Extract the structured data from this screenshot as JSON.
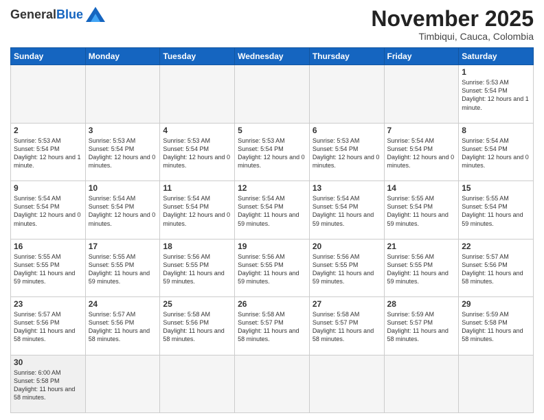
{
  "header": {
    "logo": {
      "general": "General",
      "blue": "Blue"
    },
    "title": "November 2025",
    "subtitle": "Timbiqui, Cauca, Colombia"
  },
  "days_of_week": [
    "Sunday",
    "Monday",
    "Tuesday",
    "Wednesday",
    "Thursday",
    "Friday",
    "Saturday"
  ],
  "weeks": [
    [
      {
        "day": "",
        "info": ""
      },
      {
        "day": "",
        "info": ""
      },
      {
        "day": "",
        "info": ""
      },
      {
        "day": "",
        "info": ""
      },
      {
        "day": "",
        "info": ""
      },
      {
        "day": "",
        "info": ""
      },
      {
        "day": "1",
        "info": "Sunrise: 5:53 AM\nSunset: 5:54 PM\nDaylight: 12 hours and 1 minute."
      }
    ],
    [
      {
        "day": "2",
        "info": "Sunrise: 5:53 AM\nSunset: 5:54 PM\nDaylight: 12 hours and 1 minute."
      },
      {
        "day": "3",
        "info": "Sunrise: 5:53 AM\nSunset: 5:54 PM\nDaylight: 12 hours and 0 minutes."
      },
      {
        "day": "4",
        "info": "Sunrise: 5:53 AM\nSunset: 5:54 PM\nDaylight: 12 hours and 0 minutes."
      },
      {
        "day": "5",
        "info": "Sunrise: 5:53 AM\nSunset: 5:54 PM\nDaylight: 12 hours and 0 minutes."
      },
      {
        "day": "6",
        "info": "Sunrise: 5:53 AM\nSunset: 5:54 PM\nDaylight: 12 hours and 0 minutes."
      },
      {
        "day": "7",
        "info": "Sunrise: 5:54 AM\nSunset: 5:54 PM\nDaylight: 12 hours and 0 minutes."
      },
      {
        "day": "8",
        "info": "Sunrise: 5:54 AM\nSunset: 5:54 PM\nDaylight: 12 hours and 0 minutes."
      }
    ],
    [
      {
        "day": "9",
        "info": "Sunrise: 5:54 AM\nSunset: 5:54 PM\nDaylight: 12 hours and 0 minutes."
      },
      {
        "day": "10",
        "info": "Sunrise: 5:54 AM\nSunset: 5:54 PM\nDaylight: 12 hours and 0 minutes."
      },
      {
        "day": "11",
        "info": "Sunrise: 5:54 AM\nSunset: 5:54 PM\nDaylight: 12 hours and 0 minutes."
      },
      {
        "day": "12",
        "info": "Sunrise: 5:54 AM\nSunset: 5:54 PM\nDaylight: 11 hours and 59 minutes."
      },
      {
        "day": "13",
        "info": "Sunrise: 5:54 AM\nSunset: 5:54 PM\nDaylight: 11 hours and 59 minutes."
      },
      {
        "day": "14",
        "info": "Sunrise: 5:55 AM\nSunset: 5:54 PM\nDaylight: 11 hours and 59 minutes."
      },
      {
        "day": "15",
        "info": "Sunrise: 5:55 AM\nSunset: 5:54 PM\nDaylight: 11 hours and 59 minutes."
      }
    ],
    [
      {
        "day": "16",
        "info": "Sunrise: 5:55 AM\nSunset: 5:55 PM\nDaylight: 11 hours and 59 minutes."
      },
      {
        "day": "17",
        "info": "Sunrise: 5:55 AM\nSunset: 5:55 PM\nDaylight: 11 hours and 59 minutes."
      },
      {
        "day": "18",
        "info": "Sunrise: 5:56 AM\nSunset: 5:55 PM\nDaylight: 11 hours and 59 minutes."
      },
      {
        "day": "19",
        "info": "Sunrise: 5:56 AM\nSunset: 5:55 PM\nDaylight: 11 hours and 59 minutes."
      },
      {
        "day": "20",
        "info": "Sunrise: 5:56 AM\nSunset: 5:55 PM\nDaylight: 11 hours and 59 minutes."
      },
      {
        "day": "21",
        "info": "Sunrise: 5:56 AM\nSunset: 5:55 PM\nDaylight: 11 hours and 59 minutes."
      },
      {
        "day": "22",
        "info": "Sunrise: 5:57 AM\nSunset: 5:56 PM\nDaylight: 11 hours and 58 minutes."
      }
    ],
    [
      {
        "day": "23",
        "info": "Sunrise: 5:57 AM\nSunset: 5:56 PM\nDaylight: 11 hours and 58 minutes."
      },
      {
        "day": "24",
        "info": "Sunrise: 5:57 AM\nSunset: 5:56 PM\nDaylight: 11 hours and 58 minutes."
      },
      {
        "day": "25",
        "info": "Sunrise: 5:58 AM\nSunset: 5:56 PM\nDaylight: 11 hours and 58 minutes."
      },
      {
        "day": "26",
        "info": "Sunrise: 5:58 AM\nSunset: 5:57 PM\nDaylight: 11 hours and 58 minutes."
      },
      {
        "day": "27",
        "info": "Sunrise: 5:58 AM\nSunset: 5:57 PM\nDaylight: 11 hours and 58 minutes."
      },
      {
        "day": "28",
        "info": "Sunrise: 5:59 AM\nSunset: 5:57 PM\nDaylight: 11 hours and 58 minutes."
      },
      {
        "day": "29",
        "info": "Sunrise: 5:59 AM\nSunset: 5:58 PM\nDaylight: 11 hours and 58 minutes."
      }
    ],
    [
      {
        "day": "30",
        "info": "Sunrise: 6:00 AM\nSunset: 5:58 PM\nDaylight: 11 hours and 58 minutes."
      },
      {
        "day": "",
        "info": ""
      },
      {
        "day": "",
        "info": ""
      },
      {
        "day": "",
        "info": ""
      },
      {
        "day": "",
        "info": ""
      },
      {
        "day": "",
        "info": ""
      },
      {
        "day": "",
        "info": ""
      }
    ]
  ]
}
